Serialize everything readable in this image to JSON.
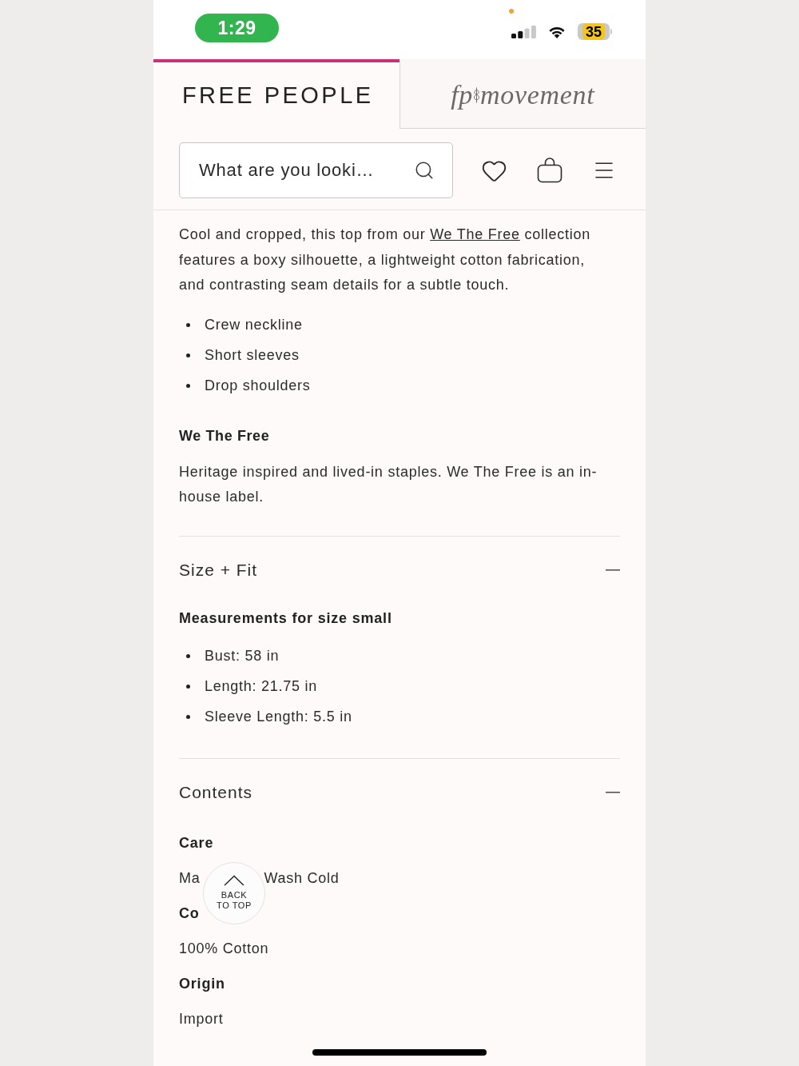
{
  "status_bar": {
    "time": "1:29",
    "battery": "35"
  },
  "header": {
    "tabs": [
      {
        "kind": "wordmark",
        "label": "FREE PEOPLE",
        "selected": true
      },
      {
        "kind": "script",
        "prefix": "fp",
        "label": "movement",
        "selected": false
      }
    ],
    "search": {
      "placeholder": "What are you looki…"
    }
  },
  "description": {
    "intro": {
      "before": "Cool and cropped, this top from our ",
      "link": "We The Free",
      "after": " collection features a boxy silhouette, a lightweight cotton fabrication, and contrasting seam details for a subtle touch."
    },
    "features": [
      "Crew neckline",
      "Short sleeves",
      "Drop shoulders"
    ],
    "brand_heading": "We The Free",
    "brand_text": "Heritage inspired and lived-in staples. We The Free is an in-house label."
  },
  "sections": [
    {
      "title": "Size + Fit",
      "expanded": true,
      "blocks": [
        {
          "kind": "list",
          "heading": "Measurements for size small",
          "items": [
            "Bust: 58 in",
            "Length: 21.75 in",
            "Sleeve Length: 5.5 in"
          ]
        }
      ]
    },
    {
      "title": "Contents",
      "expanded": true,
      "blocks": [
        {
          "kind": "text",
          "heading": "Care",
          "parts": [
            "Ma",
            "Wash Cold"
          ]
        },
        {
          "kind": "text",
          "heading": "Co",
          "parts": [
            "100% Cotton"
          ]
        },
        {
          "kind": "text",
          "heading": "Origin",
          "parts": [
            "Import"
          ]
        }
      ]
    }
  ],
  "back_to_top": {
    "label": "BACK TO TOP"
  }
}
